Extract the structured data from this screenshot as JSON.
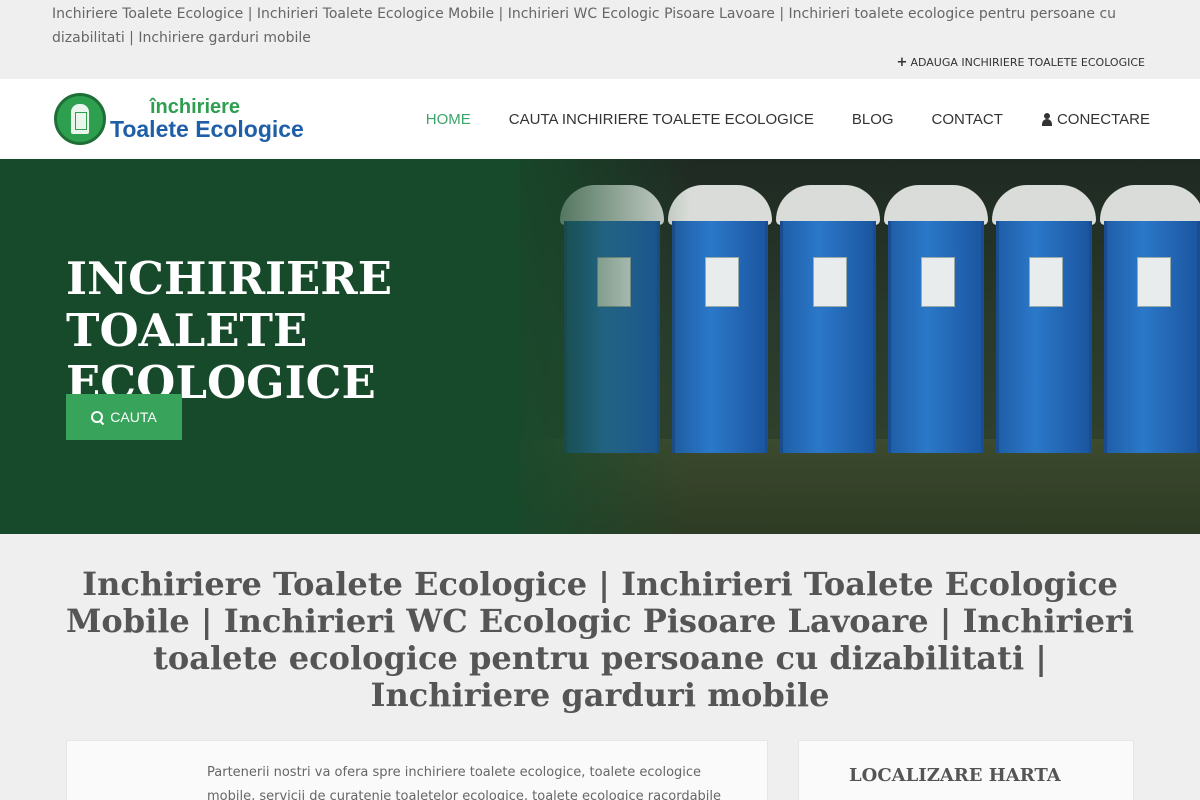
{
  "topbar": {
    "tagline": "Inchiriere Toalete Ecologice | Inchirieri Toalete Ecologice Mobile | Inchirieri WC Ecologic Pisoare Lavoare | Inchirieri toalete ecologice pentru persoane cu dizabilitati | Inchiriere garduri mobile",
    "add_link_label": "ADAUGA INCHIRIERE TOALETE ECOLOGICE",
    "add_link_icon": "plus-icon"
  },
  "header": {
    "logo_line1": "închiriere",
    "logo_line2": "Toalete Ecologice",
    "nav": [
      {
        "label": "HOME",
        "active": true
      },
      {
        "label": "CAUTA INCHIRIERE TOALETE ECOLOGICE",
        "active": false
      },
      {
        "label": "BLOG",
        "active": false
      },
      {
        "label": "CONTACT",
        "active": false
      },
      {
        "label": "CONECTARE",
        "active": false,
        "icon": "user-icon"
      }
    ]
  },
  "hero": {
    "title": "INCHIRIERE TOALETE ECOLOGICE",
    "button_label": "CAUTA",
    "button_icon": "search-icon"
  },
  "main": {
    "heading": "Inchiriere Toalete Ecologice | Inchirieri Toalete Ecologice Mobile | Inchirieri WC Ecologic Pisoare Lavoare | Inchirieri toalete ecologice pentru persoane cu dizabilitati | Inchiriere garduri mobile",
    "intro_text": "Partenerii nostri va ofera spre inchiriere toalete ecologice, toalete ecologice mobile, servicii de curatenie toaletelor ecologice, toalete ecologice racordabile sau",
    "sidebar_title": "LOCALIZARE HARTA"
  },
  "colors": {
    "accent_green": "#38a35a",
    "hero_green": "#174a2b",
    "logo_blue": "#1f5fa8",
    "nav_active": "#3aa46a"
  }
}
